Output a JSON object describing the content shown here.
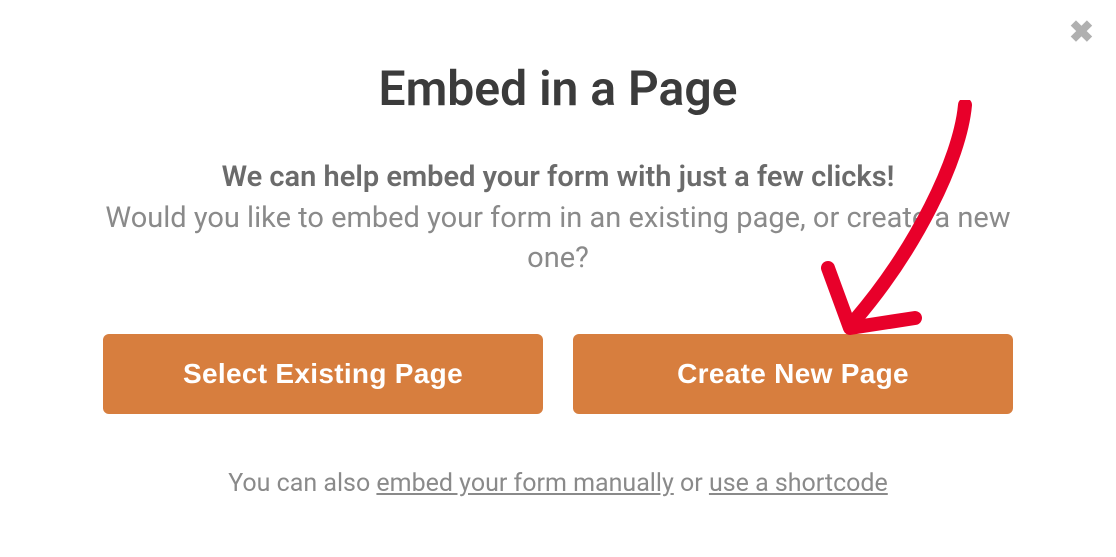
{
  "closeIcon": "✖",
  "title": "Embed in a Page",
  "lead": "We can help embed your form with just a few clicks!",
  "sub": "Would you like to embed your form in an existing page, or create a new one?",
  "buttons": {
    "selectExisting": "Select Existing Page",
    "createNew": "Create New Page"
  },
  "footer": {
    "prefix": "You can also ",
    "link1": "embed your form manually",
    "mid": " or ",
    "link2": "use a shortcode"
  }
}
